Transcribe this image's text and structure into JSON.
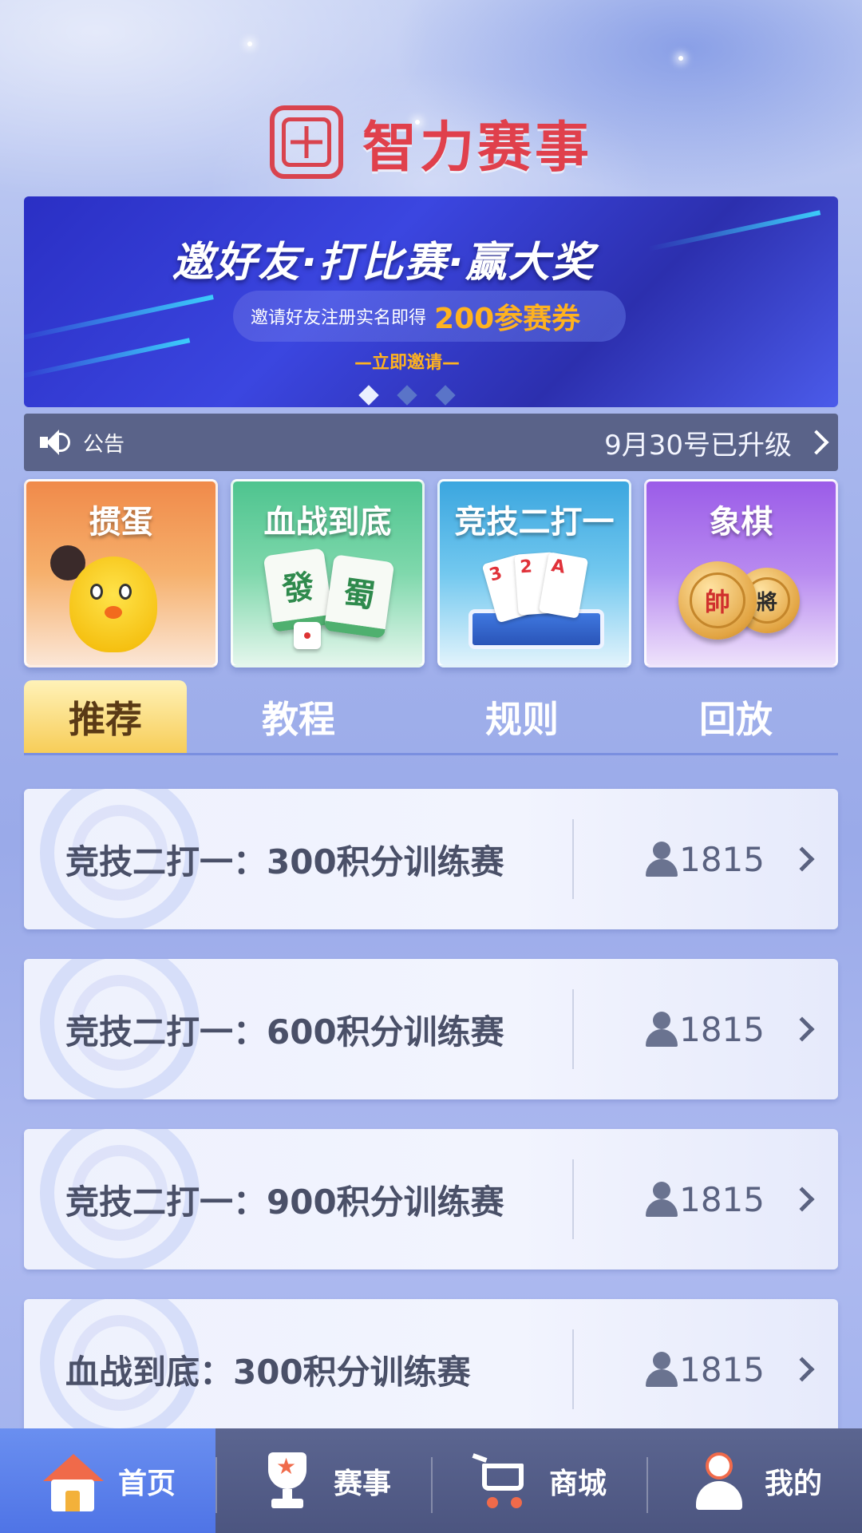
{
  "header": {
    "logo_icon": "grid-logo-icon",
    "title": "智力赛事"
  },
  "banner": {
    "headline": "邀好友·打比赛·赢大奖",
    "sub_text": "邀请好友注册实名即得",
    "highlight": "200参赛券",
    "cta": "—立即邀请—",
    "slides_total": 3,
    "slide_active": 1,
    "colors": {
      "background": "#2a2fc4",
      "highlight": "#ffb21f"
    }
  },
  "notice": {
    "icon": "speaker-icon",
    "label": "公告",
    "text": "9月30号已升级"
  },
  "games": [
    {
      "title": "掼蛋",
      "theme": "orange"
    },
    {
      "title": "血战到底",
      "theme": "green"
    },
    {
      "title": "竞技二打一",
      "theme": "blue"
    },
    {
      "title": "象棋",
      "theme": "purple"
    }
  ],
  "game_art": {
    "mahjong_tile_1": "發",
    "mahjong_tile_2": "蜀",
    "cards": [
      "3",
      "2",
      "A"
    ],
    "chess_1": "帥",
    "chess_2": "將"
  },
  "tabs": [
    {
      "label": "推荐",
      "active": true
    },
    {
      "label": "教程",
      "active": false
    },
    {
      "label": "规则",
      "active": false
    },
    {
      "label": "回放",
      "active": false
    }
  ],
  "matches": [
    {
      "title": "竞技二打一：300积分训练赛",
      "players": "1815"
    },
    {
      "title": "竞技二打一：600积分训练赛",
      "players": "1815"
    },
    {
      "title": "竞技二打一：900积分训练赛",
      "players": "1815"
    },
    {
      "title": "血战到底：300积分训练赛",
      "players": "1815"
    }
  ],
  "bottom_nav": [
    {
      "label": "首页",
      "icon": "home-icon",
      "active": true
    },
    {
      "label": "赛事",
      "icon": "trophy-icon",
      "active": false
    },
    {
      "label": "商城",
      "icon": "cart-icon",
      "active": false
    },
    {
      "label": "我的",
      "icon": "user-icon",
      "active": false
    }
  ],
  "colors": {
    "accent_red": "#e0404c",
    "tab_active": "#f7cd58",
    "nav_active": "#5b80ea",
    "nav_bg": "#525b86"
  }
}
